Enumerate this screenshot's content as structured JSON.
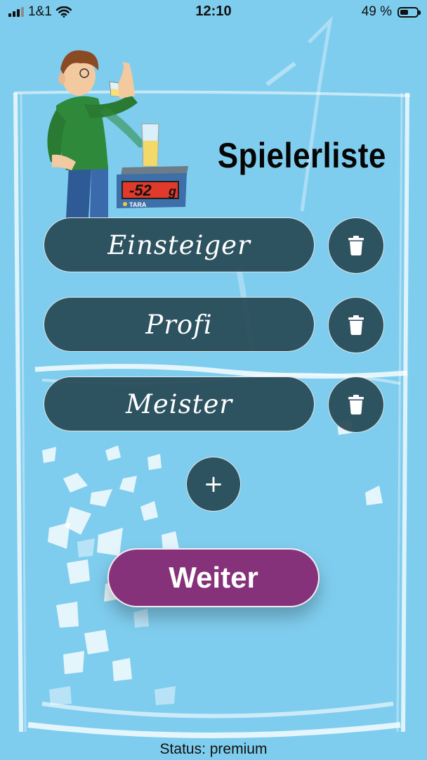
{
  "status_bar": {
    "carrier": "1&1",
    "time": "12:10",
    "battery_percent": "49 %",
    "battery_level": 0.49
  },
  "header": {
    "title": "Spielerliste"
  },
  "illustration": {
    "scale_display": "-52",
    "scale_unit": "g",
    "scale_tare": "TARA"
  },
  "players": [
    {
      "name": "Einsteiger"
    },
    {
      "name": "Profi"
    },
    {
      "name": "Meister"
    }
  ],
  "actions": {
    "add_label": "+",
    "next_label": "Weiter"
  },
  "footer": {
    "status": "Status: premium"
  },
  "colors": {
    "background": "#7fcdee",
    "pill": "#264854",
    "accent": "#86327a"
  },
  "icons": {
    "delete": "trash-icon",
    "add": "plus-icon"
  }
}
